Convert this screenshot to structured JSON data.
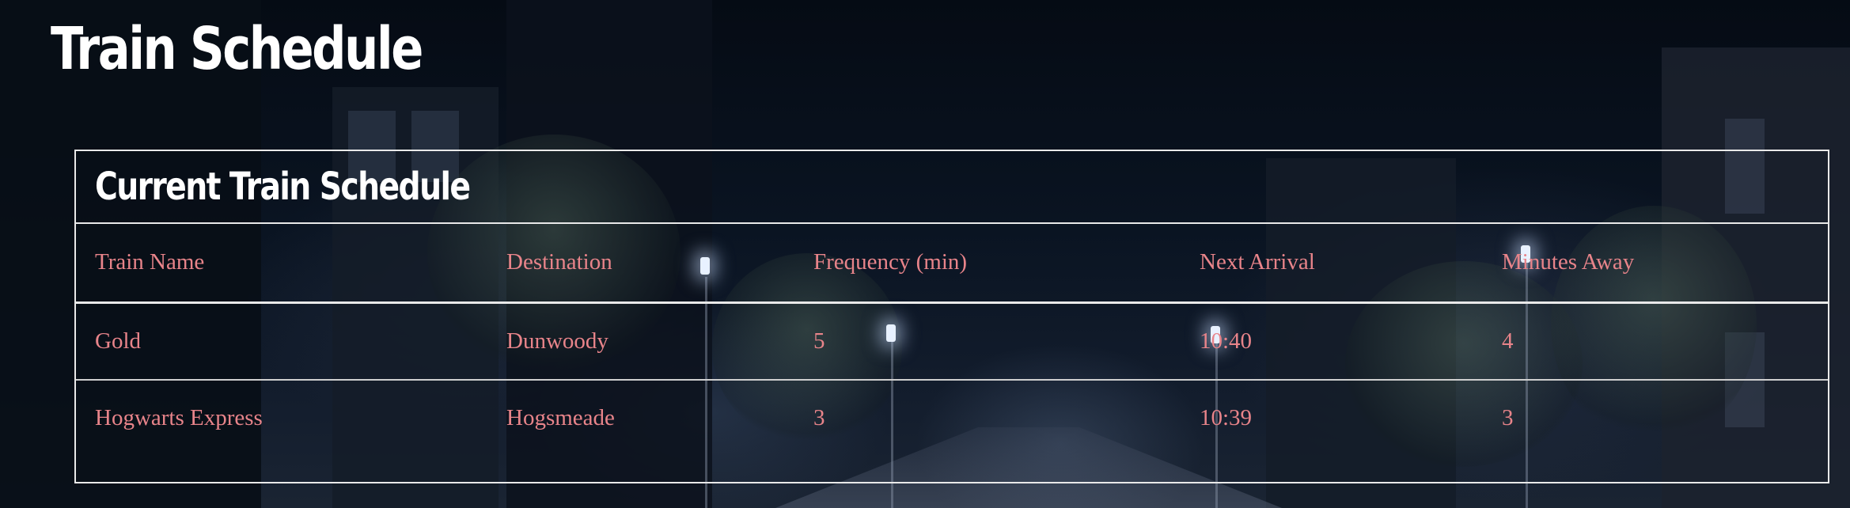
{
  "header": {
    "title": "Train Schedule"
  },
  "panel": {
    "title": "Current Train Schedule"
  },
  "table": {
    "columns": [
      "Train Name",
      "Destination",
      "Frequency (min)",
      "Next Arrival",
      "Minutes Away"
    ],
    "rows": [
      [
        "Gold",
        "Dunwoody",
        "5",
        "10:40",
        "4"
      ],
      [
        "Hogwarts Express",
        "Hogsmeade",
        "3",
        "10:39",
        "3"
      ]
    ]
  },
  "colors": {
    "text_accent": "#e8848a",
    "title": "#ffffff",
    "border": "#e9e9e9"
  }
}
